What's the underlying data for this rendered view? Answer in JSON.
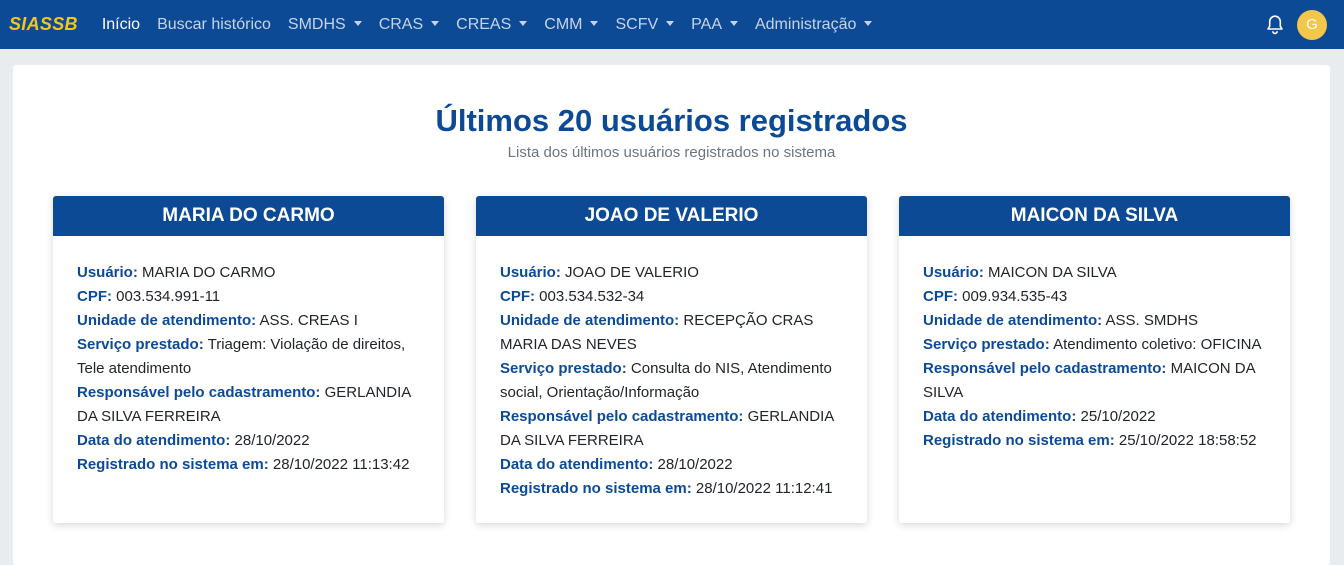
{
  "nav": {
    "brand": "SIASSB",
    "items": [
      {
        "label": "Início",
        "dropdown": false,
        "active": true
      },
      {
        "label": "Buscar histórico",
        "dropdown": false
      },
      {
        "label": "SMDHS",
        "dropdown": true
      },
      {
        "label": "CRAS",
        "dropdown": true
      },
      {
        "label": "CREAS",
        "dropdown": true
      },
      {
        "label": "CMM",
        "dropdown": true
      },
      {
        "label": "SCFV",
        "dropdown": true
      },
      {
        "label": "PAA",
        "dropdown": true
      },
      {
        "label": "Administração",
        "dropdown": true
      }
    ],
    "bell_icon": "bell-icon",
    "avatar_initial": "G"
  },
  "main": {
    "title": "Últimos 20 usuários registrados",
    "subtitle": "Lista dos últimos usuários registrados no sistema"
  },
  "labels": {
    "usuario": "Usuário:",
    "cpf": "CPF:",
    "unidade": "Unidade de atendimento:",
    "servico": "Serviço prestado:",
    "responsavel": "Responsável pelo cadastramento:",
    "data": "Data do atendimento:",
    "registrado": "Registrado no sistema em:"
  },
  "cards": [
    {
      "header": "MARIA DO CARMO",
      "usuario": "MARIA DO CARMO",
      "cpf": "003.534.991-11",
      "unidade": "ASS. CREAS I",
      "servico": "Triagem: Violação de direitos, Tele atendimento",
      "responsavel": "GERLANDIA DA SILVA FERREIRA",
      "data": "28/10/2022",
      "registrado": "28/10/2022 11:13:42"
    },
    {
      "header": "JOAO DE VALERIO",
      "usuario": "JOAO DE VALERIO",
      "cpf": "003.534.532-34",
      "unidade": "RECEPÇÃO CRAS MARIA DAS NEVES",
      "servico": "Consulta do NIS, Atendimento social, Orientação/Informação",
      "responsavel": "GERLANDIA DA SILVA FERREIRA",
      "data": "28/10/2022",
      "registrado": "28/10/2022 11:12:41"
    },
    {
      "header": "MAICON DA SILVA",
      "usuario": "MAICON DA SILVA",
      "cpf": "009.934.535-43",
      "unidade": "ASS. SMDHS",
      "servico": "Atendimento coletivo: OFICINA",
      "responsavel": "MAICON DA SILVA",
      "data": "25/10/2022",
      "registrado": "25/10/2022 18:58:52"
    }
  ],
  "colors": {
    "primary": "#0d4a96",
    "brand": "#f5c518",
    "avatar": "#f3c74a",
    "page_bg": "#e9ecef"
  }
}
